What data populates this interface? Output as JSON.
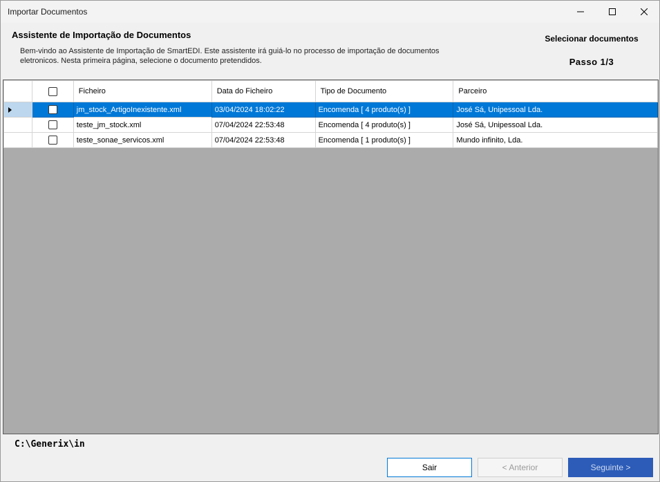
{
  "window": {
    "title": "Importar Documentos"
  },
  "header": {
    "title": "Assistente de Importação de Documentos",
    "description": "Bem-vindo ao Assistente de Importação de SmartEDI. Este assistente irá guiá-lo no processo de importação de documentos eletronicos. Nesta primeira página, selecione o documento pretendidos.",
    "step_title": "Selecionar documentos",
    "step": "Passo 1/3"
  },
  "grid": {
    "columns": [
      "Ficheiro",
      "Data do Ficheiro",
      "Tipo de Documento",
      "Parceiro"
    ],
    "rows": [
      {
        "ficheiro": "jm_stock_ArtigoInexistente.xml",
        "data": "03/04/2024 18:02:22",
        "tipo": "Encomenda [ 4 produto(s) ]",
        "parceiro": "José Sá, Unipessoal Lda.",
        "selected": true
      },
      {
        "ficheiro": "teste_jm_stock.xml",
        "data": "07/04/2024 22:53:48",
        "tipo": "Encomenda [ 4 produto(s) ]",
        "parceiro": "José Sá, Unipessoal Lda.",
        "selected": false
      },
      {
        "ficheiro": "teste_sonae_servicos.xml",
        "data": "07/04/2024 22:53:48",
        "tipo": "Encomenda [ 1 produto(s) ]",
        "parceiro": "Mundo infinito, Lda.",
        "selected": false
      }
    ]
  },
  "footer": {
    "path": "C:\\Generix\\in",
    "sair_label": "Sair",
    "anterior_label": "< Anterior",
    "seguinte_label": "Seguinte >"
  },
  "colors": {
    "selection": "#0078d7",
    "primary_button": "#2c5cb8",
    "grid_empty": "#ababab"
  }
}
